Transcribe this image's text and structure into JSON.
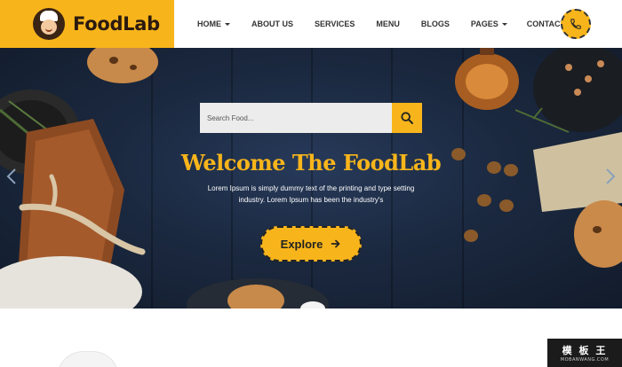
{
  "brand": {
    "name": "FoodLab",
    "accent": "#f8b51b"
  },
  "nav": {
    "items": [
      {
        "label": "HOME",
        "has_dropdown": true
      },
      {
        "label": "ABOUT US",
        "has_dropdown": false
      },
      {
        "label": "SERVICES",
        "has_dropdown": false
      },
      {
        "label": "MENU",
        "has_dropdown": false
      },
      {
        "label": "BLOGS",
        "has_dropdown": false
      },
      {
        "label": "PAGES",
        "has_dropdown": true
      },
      {
        "label": "CONTACTS",
        "has_dropdown": false
      }
    ],
    "phone_icon": "phone-icon"
  },
  "hero": {
    "search": {
      "placeholder": "Search Food...",
      "button_icon": "search-icon"
    },
    "title": "Welcome The FoodLab",
    "text_line1": "Lorem Ipsum is simply dummy text of the printing and type setting",
    "text_line2": "industry. Lorem Ipsum has been the industry's",
    "cta": {
      "label": "Explore",
      "icon": "arrow-right-icon"
    },
    "prev_icon": "chevron-left-icon",
    "next_icon": "chevron-right-icon"
  },
  "watermark": {
    "main": "模 板 王",
    "sub": "MOBANWANG.COM"
  }
}
